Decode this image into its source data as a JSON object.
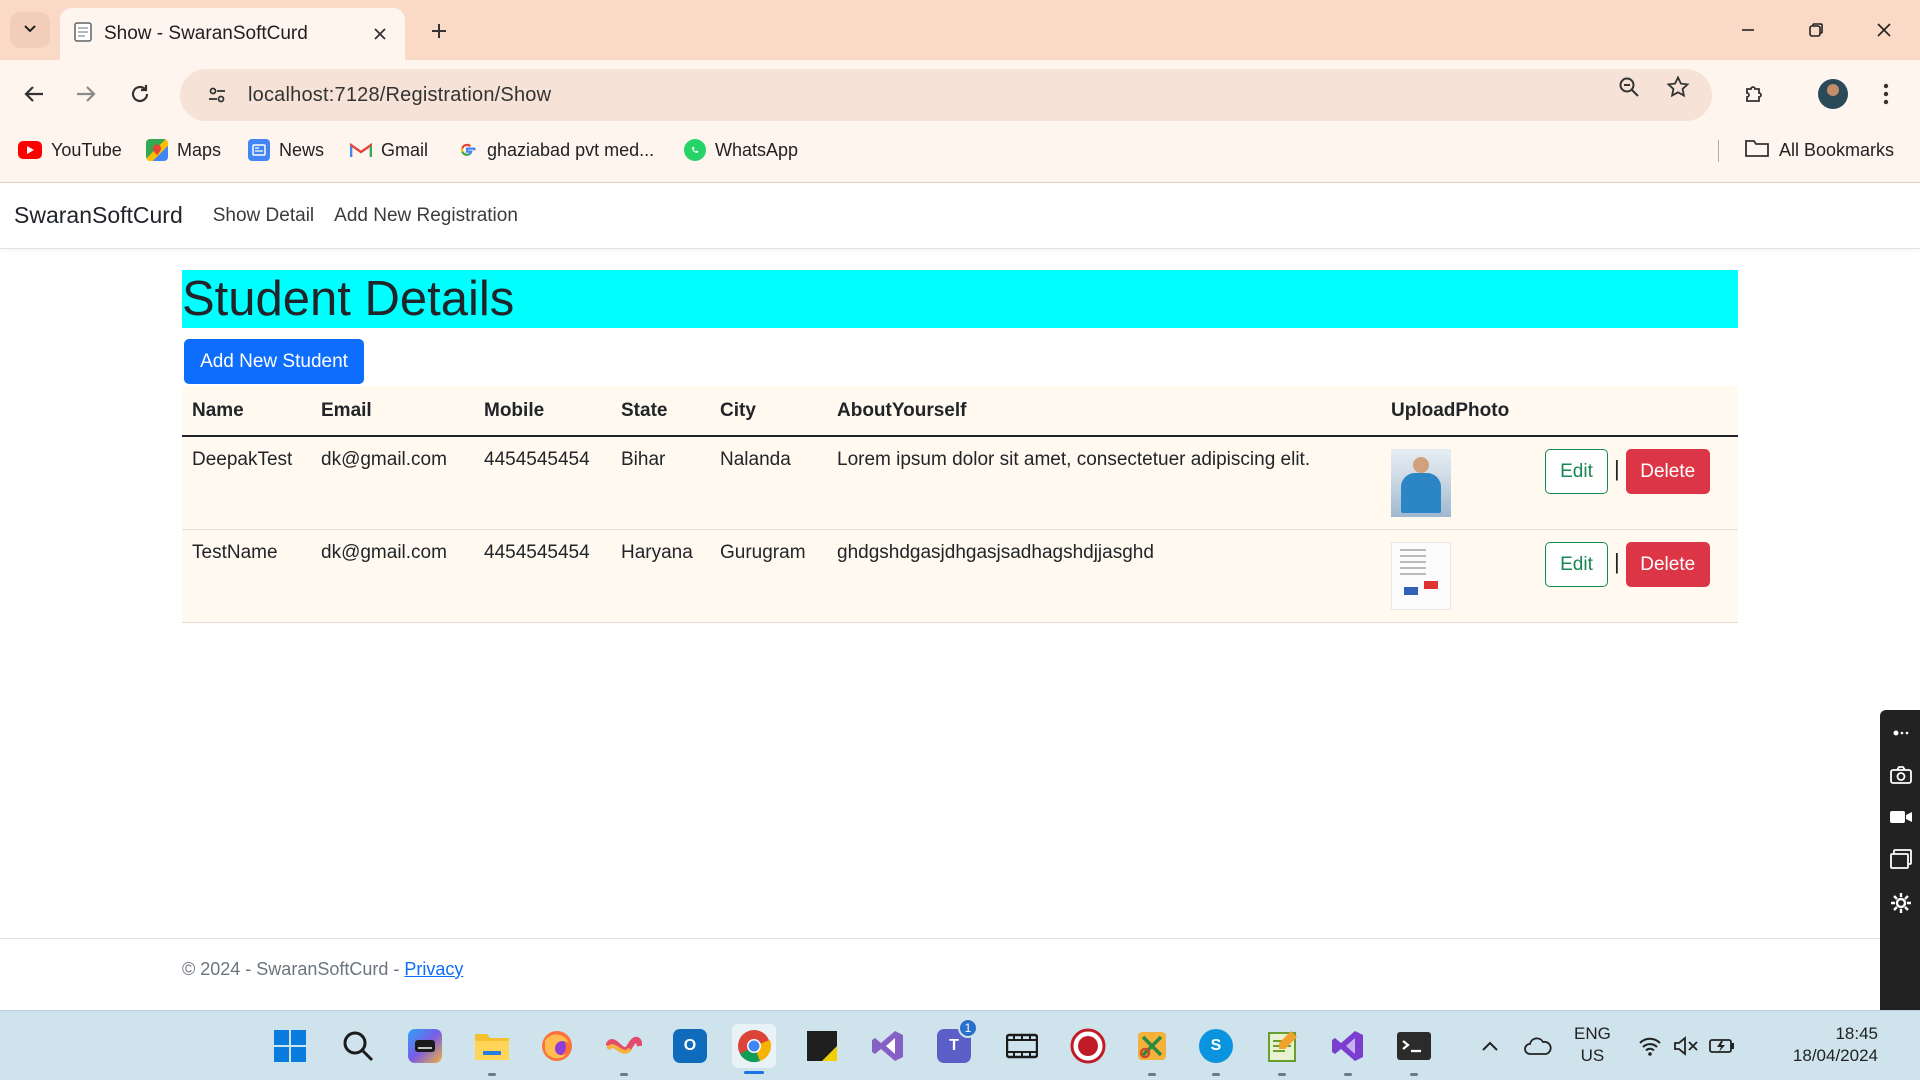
{
  "browser": {
    "tab_title": "Show - SwaranSoftCurd",
    "url": "localhost:7128/Registration/Show",
    "bookmarks": [
      {
        "label": "YouTube",
        "icon": "youtube-icon",
        "color": "#ff0000"
      },
      {
        "label": "Maps",
        "icon": "maps-icon",
        "color": "#34a853"
      },
      {
        "label": "News",
        "icon": "news-icon",
        "color": "#4285f4"
      },
      {
        "label": "Gmail",
        "icon": "gmail-icon",
        "color": "#ea4335"
      },
      {
        "label": "ghaziabad pvt med...",
        "icon": "google-icon",
        "color": "#4285f4"
      },
      {
        "label": "WhatsApp",
        "icon": "whatsapp-icon",
        "color": "#25d366"
      }
    ],
    "all_bookmarks": "All Bookmarks"
  },
  "page": {
    "brand": "SwaranSoftCurd",
    "nav": [
      "Show Detail",
      "Add New Registration"
    ],
    "heading": "Student Details",
    "add_button": "Add New Student",
    "table": {
      "columns": [
        "Name",
        "Email",
        "Mobile",
        "State",
        "City",
        "AboutYourself",
        "UploadPhoto",
        ""
      ],
      "rows": [
        {
          "name": "DeepakTest",
          "email": "dk@gmail.com",
          "mobile": "4454545454",
          "state": "Bihar",
          "city": "Nalanda",
          "about": "Lorem ipsum dolor sit amet, consectetuer adipiscing elit.",
          "photo": "person-photo"
        },
        {
          "name": "TestName",
          "email": "dk@gmail.com",
          "mobile": "4454545454",
          "state": "Haryana",
          "city": "Gurugram",
          "about": "ghdgshdgasjdhgasjsadhagshdjjasghd",
          "photo": "document-photo"
        }
      ],
      "edit_label": "Edit",
      "separator": "|",
      "delete_label": "Delete"
    },
    "footer": {
      "text": "© 2024 - SwaranSoftCurd - ",
      "link": "Privacy"
    }
  },
  "taskbar": {
    "teams_badge": "1",
    "lang_line1": "ENG",
    "lang_line2": "US",
    "time": "18:45",
    "date": "18/04/2024"
  },
  "colors": {
    "heading_bg": "#00ffff",
    "primary": "#0d6efd",
    "success": "#198754",
    "danger": "#dc3545",
    "tabstrip": "#fbd9c7"
  }
}
